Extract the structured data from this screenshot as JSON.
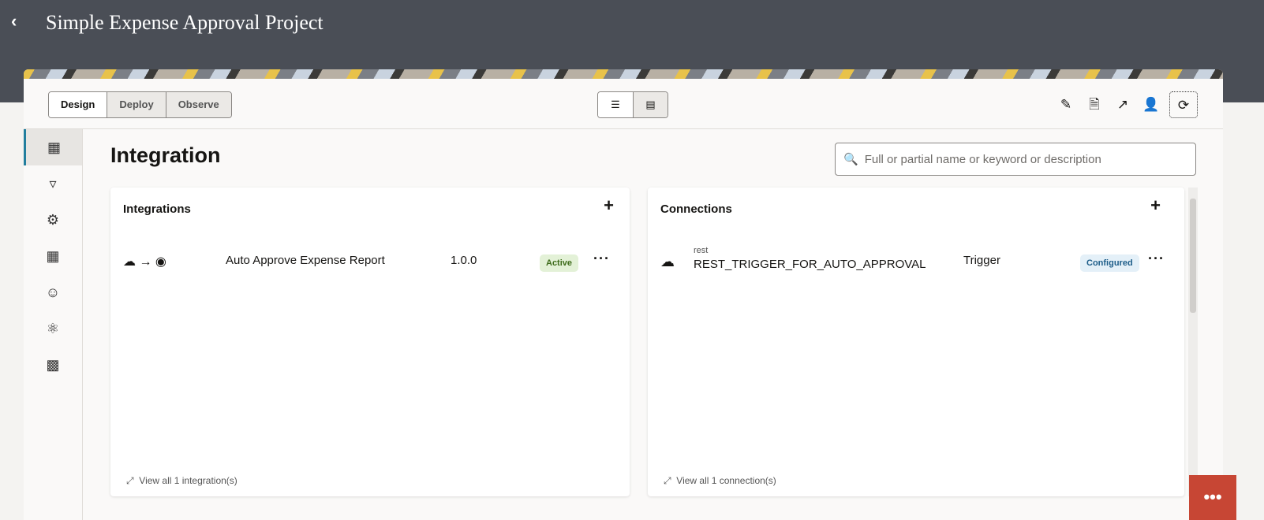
{
  "header": {
    "title": "Simple Expense Approval Project"
  },
  "tabs": [
    "Design",
    "Deploy",
    "Observe"
  ],
  "page_title": "Integration",
  "search": {
    "placeholder": "Full or partial name or keyword or description"
  },
  "integrations": {
    "title": "Integrations",
    "items": [
      {
        "name": "Auto Approve Expense Report",
        "version": "1.0.0",
        "status": "Active"
      }
    ],
    "view_all": "View all 1 integration(s)"
  },
  "connections": {
    "title": "Connections",
    "items": [
      {
        "type": "rest",
        "name": "REST_TRIGGER_FOR_AUTO_APPROVAL",
        "role": "Trigger",
        "status": "Configured"
      }
    ],
    "view_all": "View all 1 connection(s)"
  },
  "colors": {
    "active_bg": "#e3f1d7",
    "active_fg": "#3d6b1a",
    "configured_bg": "#e4f0f8",
    "configured_fg": "#1d5d89",
    "chat": "#c74634"
  }
}
